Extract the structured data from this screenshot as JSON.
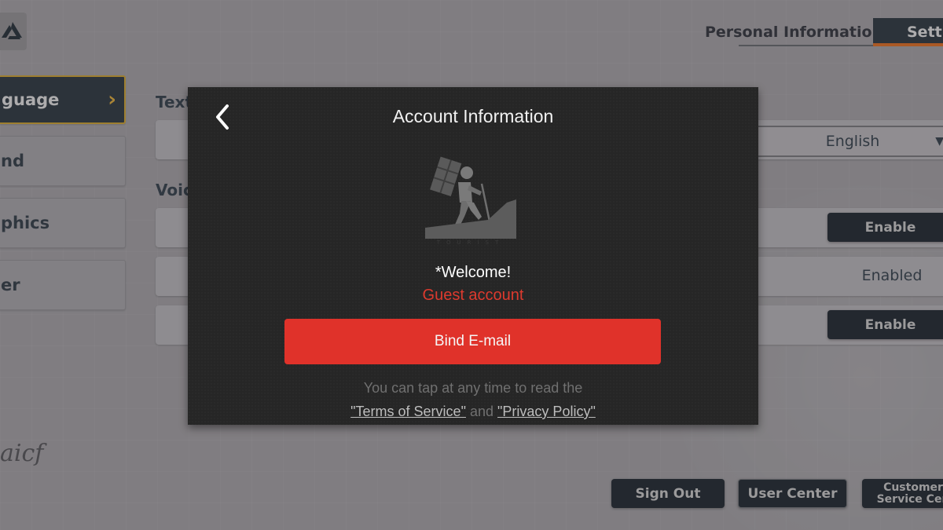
{
  "background": {
    "sidebar": {
      "items": [
        {
          "label": "guage",
          "active": true
        },
        {
          "label": "nd",
          "active": false
        },
        {
          "label": "phics",
          "active": false
        },
        {
          "label": "er",
          "active": false
        }
      ]
    },
    "header": {
      "tabs": [
        {
          "label": "Personal Information",
          "active": false
        },
        {
          "label": "Setti",
          "active": true
        }
      ]
    },
    "sections": {
      "text_label": "Text",
      "voice_label": "Voic"
    },
    "language_select": {
      "value": "English",
      "caret": "▼"
    },
    "voice_rows": [
      {
        "action": "Enable",
        "type": "button"
      },
      {
        "action": "Enabled",
        "type": "status"
      },
      {
        "action": "Enable",
        "type": "button"
      }
    ],
    "bottom_buttons": {
      "sign_out": "Sign Out",
      "user_center": "User Center",
      "customer_service": "Customer Service Cen"
    },
    "signature": "aicf"
  },
  "modal": {
    "title": "Account Information",
    "back_icon": "chevron-left-icon",
    "avatar_caption": "TOURIST",
    "welcome": "*Welcome!",
    "account_type": "Guest account",
    "bind_button": "Bind E-mail",
    "note_line1": "You can tap at any time to read the",
    "terms_link": "\"Terms of Service\"",
    "and_text": "and",
    "privacy_link": "\"Privacy Policy\"",
    "colors": {
      "accent": "#e0322a",
      "guest_text": "#dd3a2e",
      "panel": "#262626"
    }
  }
}
